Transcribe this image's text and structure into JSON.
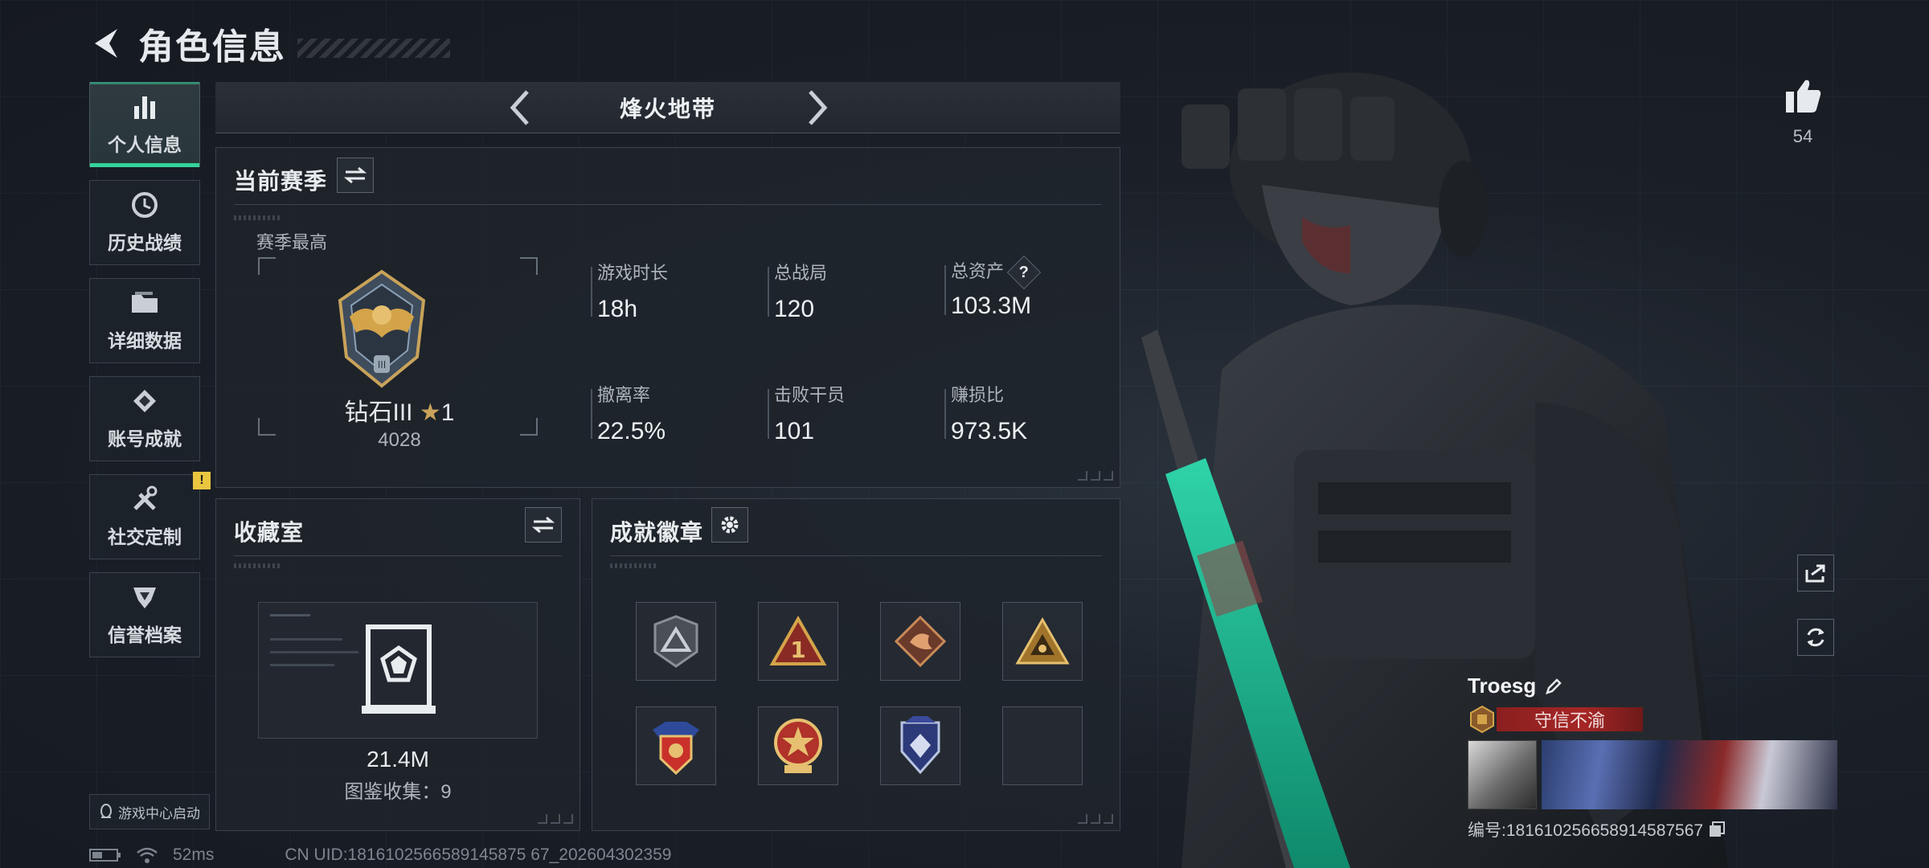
{
  "header": {
    "title": "角色信息"
  },
  "sidebar": {
    "items": [
      {
        "label": "个人信息",
        "icon": "bar-chart-icon",
        "active": true
      },
      {
        "label": "历史战绩",
        "icon": "history-clock-icon",
        "active": false
      },
      {
        "label": "详细数据",
        "icon": "folder-icon",
        "active": false
      },
      {
        "label": "账号成就",
        "icon": "achievement-icon",
        "active": false
      },
      {
        "label": "社交定制",
        "icon": "tools-icon",
        "active": false,
        "badge": "!"
      },
      {
        "label": "信誉档案",
        "icon": "credit-shield-icon",
        "active": false
      }
    ],
    "game_center": "游戏中心启动"
  },
  "mode": {
    "title": "烽火地带"
  },
  "season": {
    "title": "当前赛季",
    "best_label": "赛季最高",
    "rank_name": "钻石III",
    "rank_stars": "1",
    "rank_score": "4028",
    "stats": [
      {
        "label": "游戏时长",
        "value": "18h"
      },
      {
        "label": "总战局",
        "value": "120"
      },
      {
        "label": "总资产",
        "value": "103.3M",
        "help": "?"
      },
      {
        "label": "撤离率",
        "value": "22.5%"
      },
      {
        "label": "击败干员",
        "value": "101"
      },
      {
        "label": "赚损比",
        "value": "973.5K"
      }
    ]
  },
  "collection": {
    "title": "收藏室",
    "value": "21.4M",
    "count_text": "图鉴收集：9"
  },
  "achievements": {
    "title": "成就徽章",
    "badges": [
      "grey-triangle-badge",
      "red-rank-one-badge",
      "dragon-badge",
      "gold-triangle-badge",
      "winged-shield-badge",
      "star-medal-badge",
      "blue-diamond-shield-badge",
      "empty-slot"
    ]
  },
  "profile": {
    "likes": "54",
    "name": "Troesg",
    "title": "守信不渝",
    "id_text": "编号:1816102566589145875​67"
  },
  "status": {
    "ping": "52ms",
    "uid": "CN UID:1816102566589145875 67_202604302359"
  },
  "colors": {
    "accent": "#34d39a",
    "title_red": "#a62626",
    "warn": "#e9c540"
  }
}
